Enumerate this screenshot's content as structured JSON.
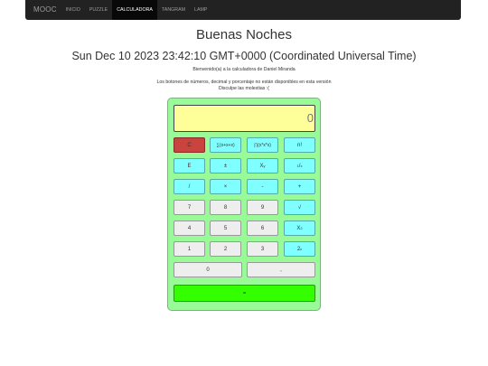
{
  "nav": {
    "brand": "MOOC",
    "links": [
      "INICIO",
      "PUZZLE",
      "CALCULADORA",
      "TANGRAM",
      "LAMP"
    ]
  },
  "greeting": "Buenas Noches",
  "datetime": "Sun Dec 10 2023 23:42:10 GMT+0000 (Coordinated Universal Time)",
  "welcome": "Bienvenido(a) a la calculadora de Daniel Miranda",
  "notice_line1": "Los botones de números, decimal y porcentaje no están disponibles en esta versión",
  "notice_line2": "Disculpe las molestias :(",
  "calculator": {
    "display_value": "0",
    "keys": {
      "clear": "C",
      "sum": "∑(x+x+x)",
      "product": "∏(x*x*x)",
      "factorial": "n!",
      "exp": "E",
      "sign": "±",
      "power": "X",
      "power_sup": "y",
      "reciprocal_num": "1",
      "reciprocal_den": "x",
      "divide": "/",
      "multiply": "×",
      "minus": "-",
      "plus": "+",
      "seven": "7",
      "eight": "8",
      "nine": "9",
      "sqrt": "√",
      "four": "4",
      "five": "5",
      "six": "6",
      "square": "X",
      "square_sup": "2",
      "one": "1",
      "two": "2",
      "three": "3",
      "two_pow": "2",
      "two_pow_sup": "x",
      "zero": "0",
      "decimal": ",",
      "equals": "="
    },
    "colors": {
      "body": "#98fb98",
      "display": "#ffff99",
      "operator": "#7fffff",
      "clear": "#c9433f",
      "equals": "#33ff00",
      "digit": "#eeeeee"
    }
  }
}
